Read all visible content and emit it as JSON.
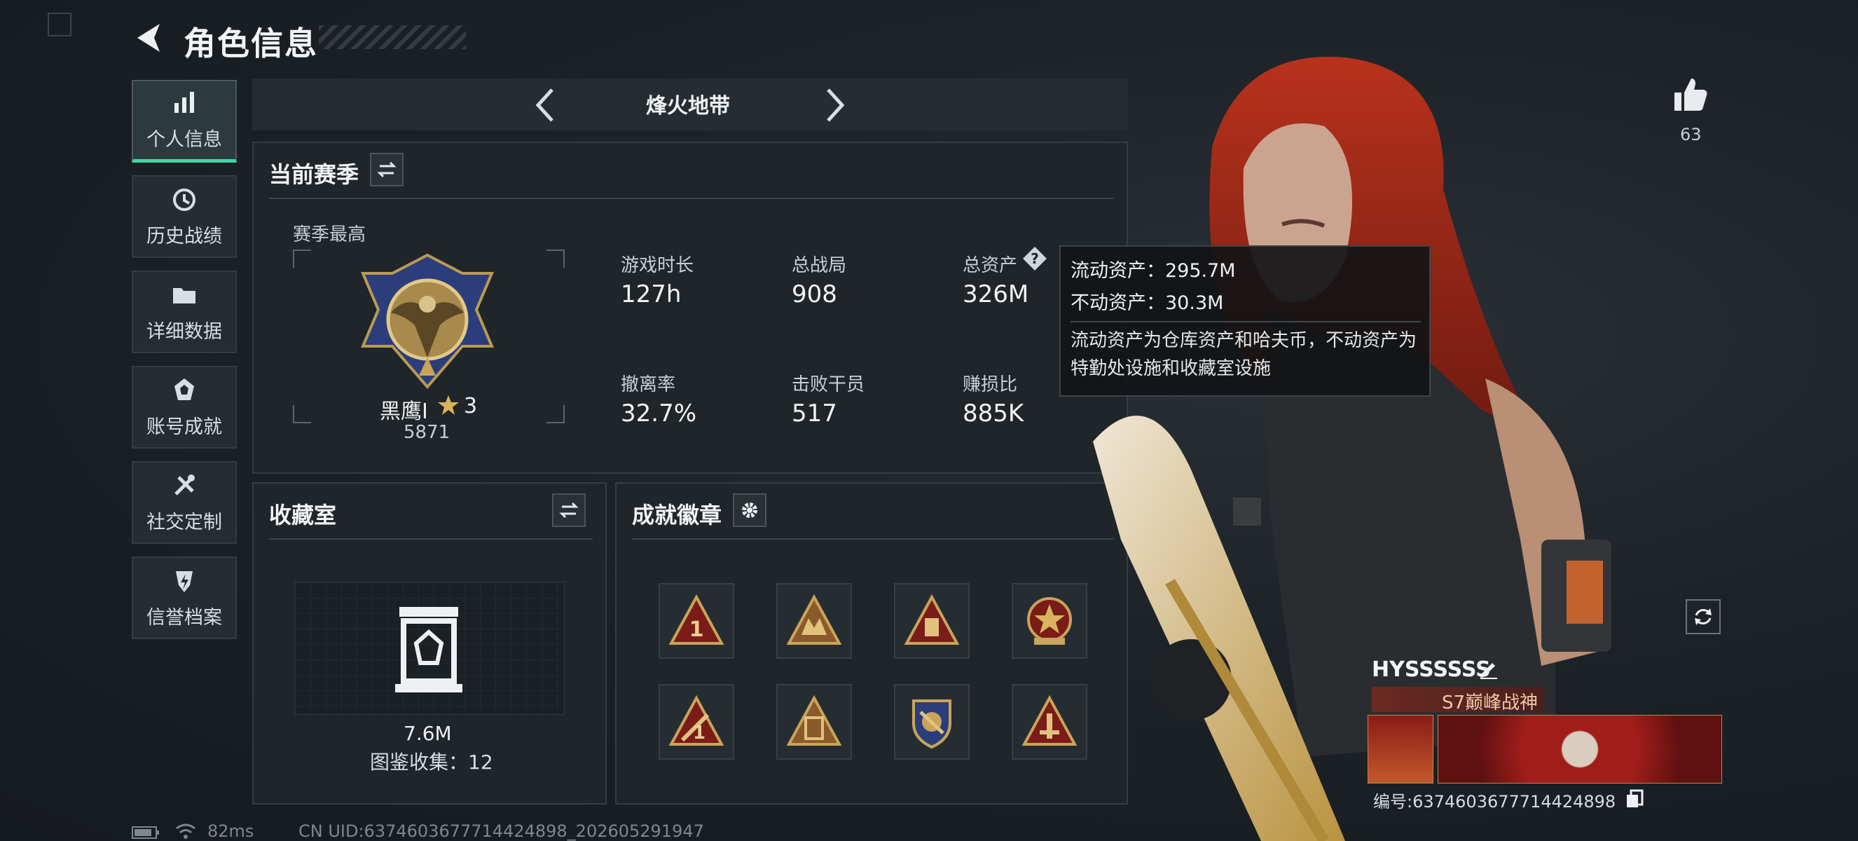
{
  "header": {
    "title": "角色信息"
  },
  "sidebar": {
    "items": [
      {
        "label": "个人信息",
        "icon": "bar-chart-icon",
        "active": true
      },
      {
        "label": "历史战绩",
        "icon": "history-clock-icon",
        "active": false
      },
      {
        "label": "详细数据",
        "icon": "folder-icon",
        "active": false
      },
      {
        "label": "账号成就",
        "icon": "achievement-icon",
        "active": false
      },
      {
        "label": "社交定制",
        "icon": "tools-icon",
        "active": false
      },
      {
        "label": "信誉档案",
        "icon": "shield-icon",
        "active": false
      }
    ]
  },
  "mode": {
    "label": "烽火地带"
  },
  "season": {
    "title": "当前赛季",
    "best_label": "赛季最高",
    "rank_name": "黑鹰I",
    "rank_stars": "3",
    "rank_points": "5871",
    "stats": [
      {
        "label": "游戏时长",
        "value": "127h"
      },
      {
        "label": "总战局",
        "value": "908"
      },
      {
        "label": "总资产",
        "value": "326M"
      },
      {
        "label": "撤离率",
        "value": "32.7%"
      },
      {
        "label": "击败干员",
        "value": "517"
      },
      {
        "label": "赚损比",
        "value": "885K"
      }
    ]
  },
  "tooltip": {
    "liquid": "流动资产：295.7M",
    "fixed": "不动资产：30.3M",
    "desc": "流动资产为仓库资产和哈夫币，不动资产为特勤处设施和收藏室设施"
  },
  "collection": {
    "title": "收藏室",
    "value": "7.6M",
    "count_text": "图鉴收集：12"
  },
  "badges": {
    "title": "成就徽章",
    "items": [
      "badge-1",
      "badge-2",
      "badge-3",
      "badge-4",
      "badge-5",
      "badge-6",
      "badge-7",
      "badge-8"
    ]
  },
  "profile": {
    "likes": "63",
    "name": "HYSSSSSS",
    "title_tag": "S7巅峰战神",
    "id_text": "编号:6374603677714424898"
  },
  "status_bar": {
    "ping": "82ms",
    "uid": "CN UID:6374603677714424898_202605291947"
  },
  "colors": {
    "accent": "#3fd6a4",
    "panel": "#1f2529",
    "gold": "#c9a45a",
    "badge_red": "#7a1c17"
  }
}
